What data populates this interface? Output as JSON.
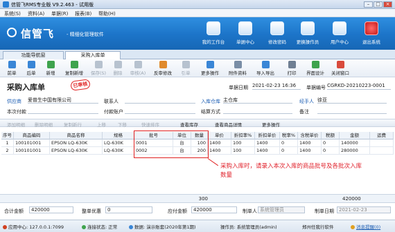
{
  "window": {
    "title": "信管飞RMS专业版 V9.2.463 - 试用版"
  },
  "menu": [
    "系统(S)",
    "资料(A)",
    "单据(R)",
    "报表(B)",
    "帮助(H)"
  ],
  "banner": {
    "brand": "信管飞",
    "slogan": "- 精细化管理软件",
    "buttons": [
      {
        "label": "我的工作台"
      },
      {
        "label": "单据中心"
      },
      {
        "label": "修改密码"
      },
      {
        "label": "更换操作员"
      },
      {
        "label": "用户中心"
      },
      {
        "label": "退出系统"
      }
    ]
  },
  "tabs": [
    {
      "label": "功能导航窗"
    },
    {
      "label": "采购入库单"
    }
  ],
  "toolbar": [
    {
      "label": "前单",
      "enabled": true
    },
    {
      "label": "后单",
      "enabled": true
    },
    {
      "label": "新增",
      "enabled": true
    },
    {
      "label": "复制新增",
      "enabled": true
    },
    {
      "label": "保存(S)",
      "enabled": false
    },
    {
      "label": "删除",
      "enabled": false
    },
    {
      "label": "审核(A)",
      "enabled": false
    },
    {
      "label": "反审修改",
      "enabled": true
    },
    {
      "label": "引单",
      "enabled": false
    },
    {
      "label": "更多操作",
      "enabled": true
    },
    {
      "label": "附件资料",
      "enabled": true
    },
    {
      "label": "导入导出",
      "enabled": true
    },
    {
      "label": "打印",
      "enabled": true
    },
    {
      "label": "界面设计",
      "enabled": true
    },
    {
      "label": "关闭窗口",
      "enabled": true
    }
  ],
  "form": {
    "title": "采购入库单",
    "stamp": "已审核",
    "date_label": "单据日期",
    "date_value": "2021-02-23 16:36",
    "no_label": "单据编号",
    "no_value": "CGRKD-20210223-0001",
    "supplier_label": "供应商",
    "supplier_value": "爱普生中国有限公司",
    "contact_label": "联系人",
    "warehouse_label": "入库仓库",
    "warehouse_value": "主仓库",
    "handler_label": "经手人",
    "handler_value": "徐亚",
    "payment_label": "本次付款",
    "account_label": "付款账户",
    "settle_label": "结算方式",
    "remark_label": "备注"
  },
  "subtoolbar": [
    "添加明细",
    "删除明细",
    "复制新行",
    "上移",
    "下移",
    "快速排序",
    "查看库存",
    "查看商品详情",
    "更多操作"
  ],
  "grid": {
    "columns": [
      "序号",
      "商品编码",
      "商品名称",
      "规格",
      "批号",
      "单位",
      "数量",
      "单价",
      "折扣率%",
      "折扣单价",
      "税率%",
      "含税单价",
      "税额",
      "金额",
      "运费"
    ],
    "rows": [
      {
        "no": "1",
        "code": "100101001",
        "name": "EPSON LQ-630K",
        "spec": "LQ-630K",
        "batch": "0001",
        "unit": "台",
        "qty": "100",
        "price": "1400",
        "disc": "100",
        "dprice": "1400",
        "tax": "0",
        "tprice": "1400",
        "taxamt": "0",
        "amount": "140000"
      },
      {
        "no": "2",
        "code": "100101001",
        "name": "EPSON LQ-630K",
        "spec": "LQ-630K",
        "batch": "0002",
        "unit": "台",
        "qty": "200",
        "price": "1400",
        "disc": "100",
        "dprice": "1400",
        "tax": "0",
        "tprice": "1400",
        "taxamt": "0",
        "amount": "280000"
      }
    ],
    "total_qty": "300",
    "total_amount": "420000"
  },
  "annotation": "采购入库时，请录入本次入库的商品批号及各批次入库数量",
  "footer": {
    "total_label": "合计金额",
    "total_value": "420000",
    "discount_label": "整单优惠",
    "discount_value": "0",
    "payable_label": "应付金额",
    "payable_value": "420000",
    "maker_label": "制单人",
    "maker_value": "系统管理员",
    "makedate_label": "制单日期",
    "makedate_value": "2021-02-23"
  },
  "statusbar": {
    "appcenter": "应用中心: 127.0.0.1:7099",
    "conn": "连接状态: 正常",
    "db": "数据: 演示账套(2020年第1期)",
    "operator": "操作员: 系统管理员(admin)",
    "company": "郑州任我行软件",
    "msg": "消息提醒(0)"
  },
  "colors": {
    "accent": "#1c74c8",
    "annotation": "#e02020"
  }
}
